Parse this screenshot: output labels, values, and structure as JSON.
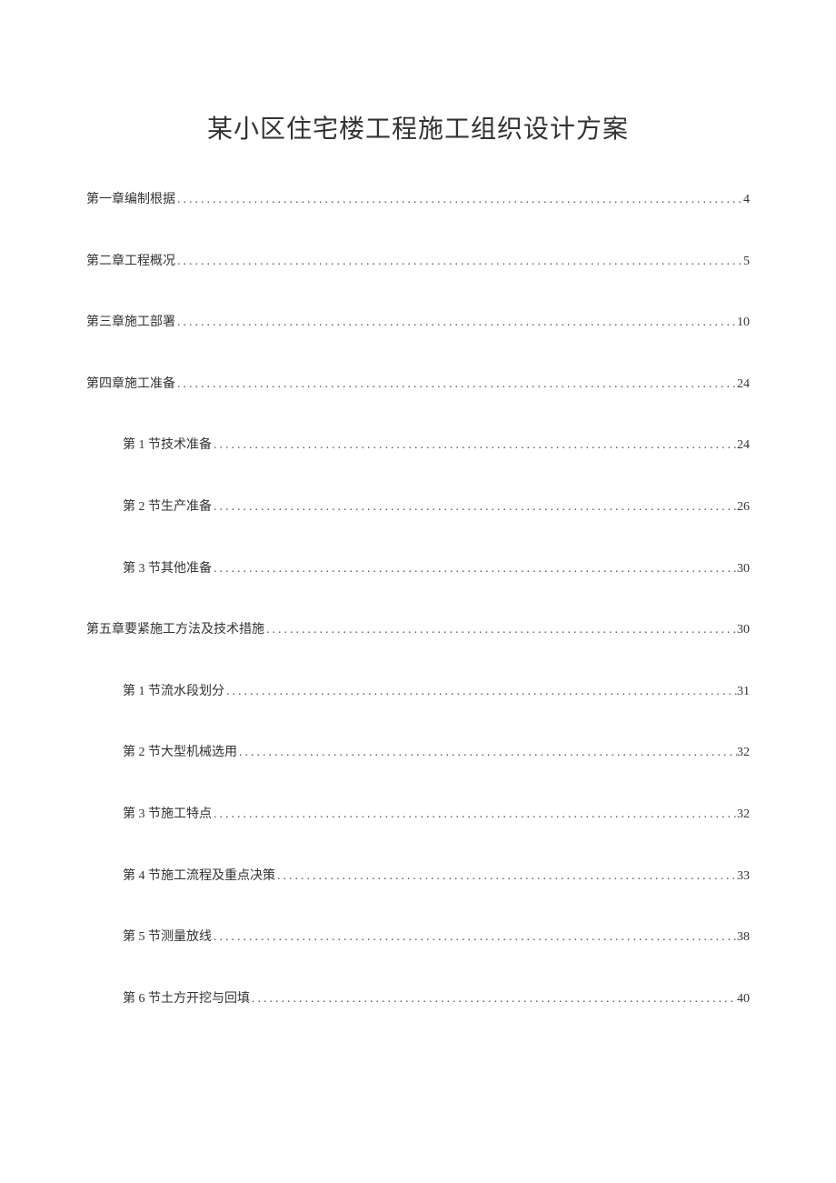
{
  "title": "某小区住宅楼工程施工组织设计方案",
  "toc": [
    {
      "level": 1,
      "label": "第一章编制根据",
      "page": "4"
    },
    {
      "level": 1,
      "label": "第二章工程概况",
      "page": "5"
    },
    {
      "level": 1,
      "label": "第三章施工部署",
      "page": "10"
    },
    {
      "level": 1,
      "label": "第四章施工准备",
      "page": "24"
    },
    {
      "level": 2,
      "label": "第 1 节技术准备",
      "page": "24"
    },
    {
      "level": 2,
      "label": "第 2 节生产准备",
      "page": "26"
    },
    {
      "level": 2,
      "label": "第 3 节其他准备",
      "page": "30"
    },
    {
      "level": 1,
      "label": "第五章要紧施工方法及技术措施",
      "page": "30"
    },
    {
      "level": 2,
      "label": "第 1 节流水段划分",
      "page": "31"
    },
    {
      "level": 2,
      "label": "第 2 节大型机械选用",
      "page": "32"
    },
    {
      "level": 2,
      "label": "第 3 节施工特点",
      "page": "32"
    },
    {
      "level": 2,
      "label": "第 4 节施工流程及重点决策",
      "page": "33"
    },
    {
      "level": 2,
      "label": "第 5 节测量放线",
      "page": "38"
    },
    {
      "level": 2,
      "label": "第 6 节土方开挖与回填",
      "page": "40"
    }
  ]
}
